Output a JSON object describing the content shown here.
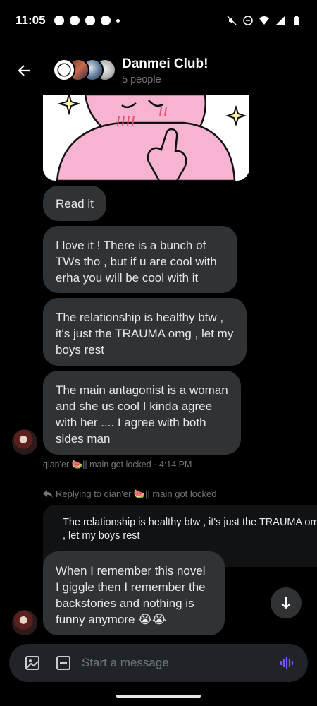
{
  "status_bar": {
    "time": "11:05",
    "left_icons": [
      "chat-bubble-icon",
      "messenger-icon",
      "snapchat-icon",
      "discord-icon",
      "dot-icon"
    ],
    "right_icons": [
      "mute-icon",
      "dnd-icon",
      "wifi-icon",
      "signal-icon",
      "battery-icon"
    ]
  },
  "header": {
    "title": "Danmei Club!",
    "subtitle": "5 people"
  },
  "messages": [
    {
      "text": "Read it"
    },
    {
      "text": "I love it ! There is a bunch of TWs tho , but if u are cool with erha you will be cool with it"
    },
    {
      "text": "The relationship is healthy btw , it's just the TRAUMA omg , let my boys rest"
    },
    {
      "text": "The main antagonist is a woman and she us cool I kinda agree with her .... I agree with both sides man"
    }
  ],
  "meta": {
    "sender": "qian'er 🍉|| main got locked",
    "time": "4:14 PM"
  },
  "reply": {
    "label": "Replying to qian'er 🍉|| main got locked",
    "quote": "The relationship is healthy btw , it's just the TRAUMA omg , let my boys rest",
    "message": "When I remember this novel I giggle then I remember the backstories and nothing is funny anymore 😭😭"
  },
  "composer": {
    "placeholder": "Start a message"
  },
  "colors": {
    "background": "#000000",
    "bubble": "#2f3336",
    "composer": "#202327",
    "muted_text": "#71767b",
    "voice_accent": "#7856ff",
    "sticker_pink": "#f7b3d2"
  }
}
